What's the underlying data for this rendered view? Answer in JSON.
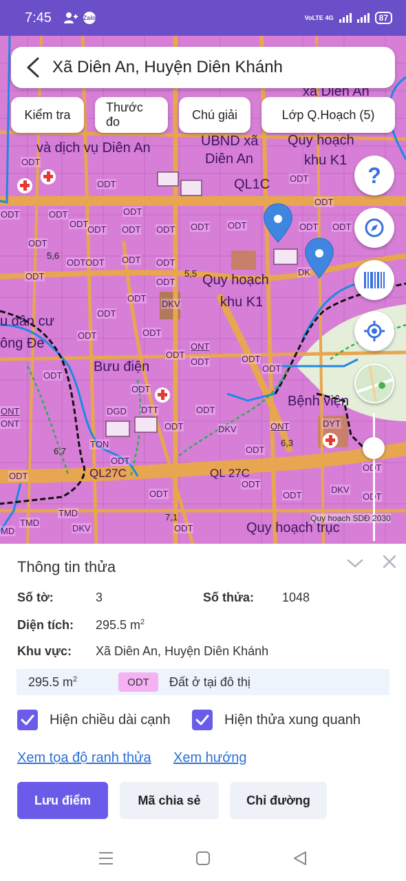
{
  "status": {
    "time": "7:45",
    "notification_app": "Zalo",
    "network_badge": "VoLTE",
    "network_type": "4G",
    "battery": "87"
  },
  "header": {
    "title": "Xã Diên An, Huyện Diên Khánh"
  },
  "toolbar": {
    "chips": [
      "Kiểm tra",
      "Thước đo",
      "Chú giải",
      "Lớp Q.Hoạch (5)"
    ]
  },
  "map": {
    "labels": {
      "dv": "và dịch vụ Diên An",
      "ubnd1": "UBND xã",
      "ubnd2": "Diên An",
      "xadien": "xã Diên An",
      "qh_k1a_1": "Quy hoạch",
      "qh_k1a_2": "khu K1",
      "ql1c": "QL1C",
      "qh_k1b_1": "Quy hoạch",
      "qh_k1b_2": "khu K1",
      "dancu": "u dân cư",
      "dongde": "ông Đe",
      "buudien": "Bưu điện",
      "benhvien": "Bệnh viện",
      "ql27c_a": "QL27C",
      "ql27c_b": "QL 27C",
      "qhtruc": "Quy hoạch trục",
      "n56": "5,6",
      "n55": "5,5",
      "n67": "6,7",
      "n71": "7,1",
      "n63": "6,3"
    },
    "zone_codes": {
      "odt": "ODT",
      "odtodt": "ODTODT",
      "dkv": "DKV",
      "ont": "ONT",
      "dgd": "DGD",
      "dtt": "DTT",
      "ton": "TON",
      "tmd": "TMD",
      "dyt": "DYT",
      "md": "MD",
      "dk": "DK"
    },
    "watermark": "Quy hoạch SDĐ 2030",
    "colors": {
      "residential": "#d77fd7",
      "road": "#e7a64f",
      "boundary": "#1e88e5",
      "marker": "#3f86e0"
    }
  },
  "panel": {
    "title": "Thông tin thửa",
    "so_to_label": "Số tờ:",
    "so_to_value": "3",
    "so_thua_label": "Số thửa:",
    "so_thua_value": "1048",
    "dien_tich_label": "Diện tích:",
    "dien_tich_value": "295.5 m",
    "dien_tich_unit": "2",
    "khu_vuc_label": "Khu vực:",
    "khu_vuc_value": "Xã Diên An, Huyện Diên Khánh",
    "landuse": {
      "area": "295.5 m",
      "unit": "2",
      "code": "ODT",
      "description": "Đất ở tại đô thị"
    },
    "checkboxes": [
      {
        "label": "Hiện chiều dài cạnh",
        "checked": true
      },
      {
        "label": "Hiện thửa xung quanh",
        "checked": true
      }
    ],
    "links": [
      "Xem tọa độ ranh thửa",
      "Xem hướng"
    ],
    "buttons": [
      "Lưu điểm",
      "Mã chia sẻ",
      "Chỉ đường"
    ]
  }
}
